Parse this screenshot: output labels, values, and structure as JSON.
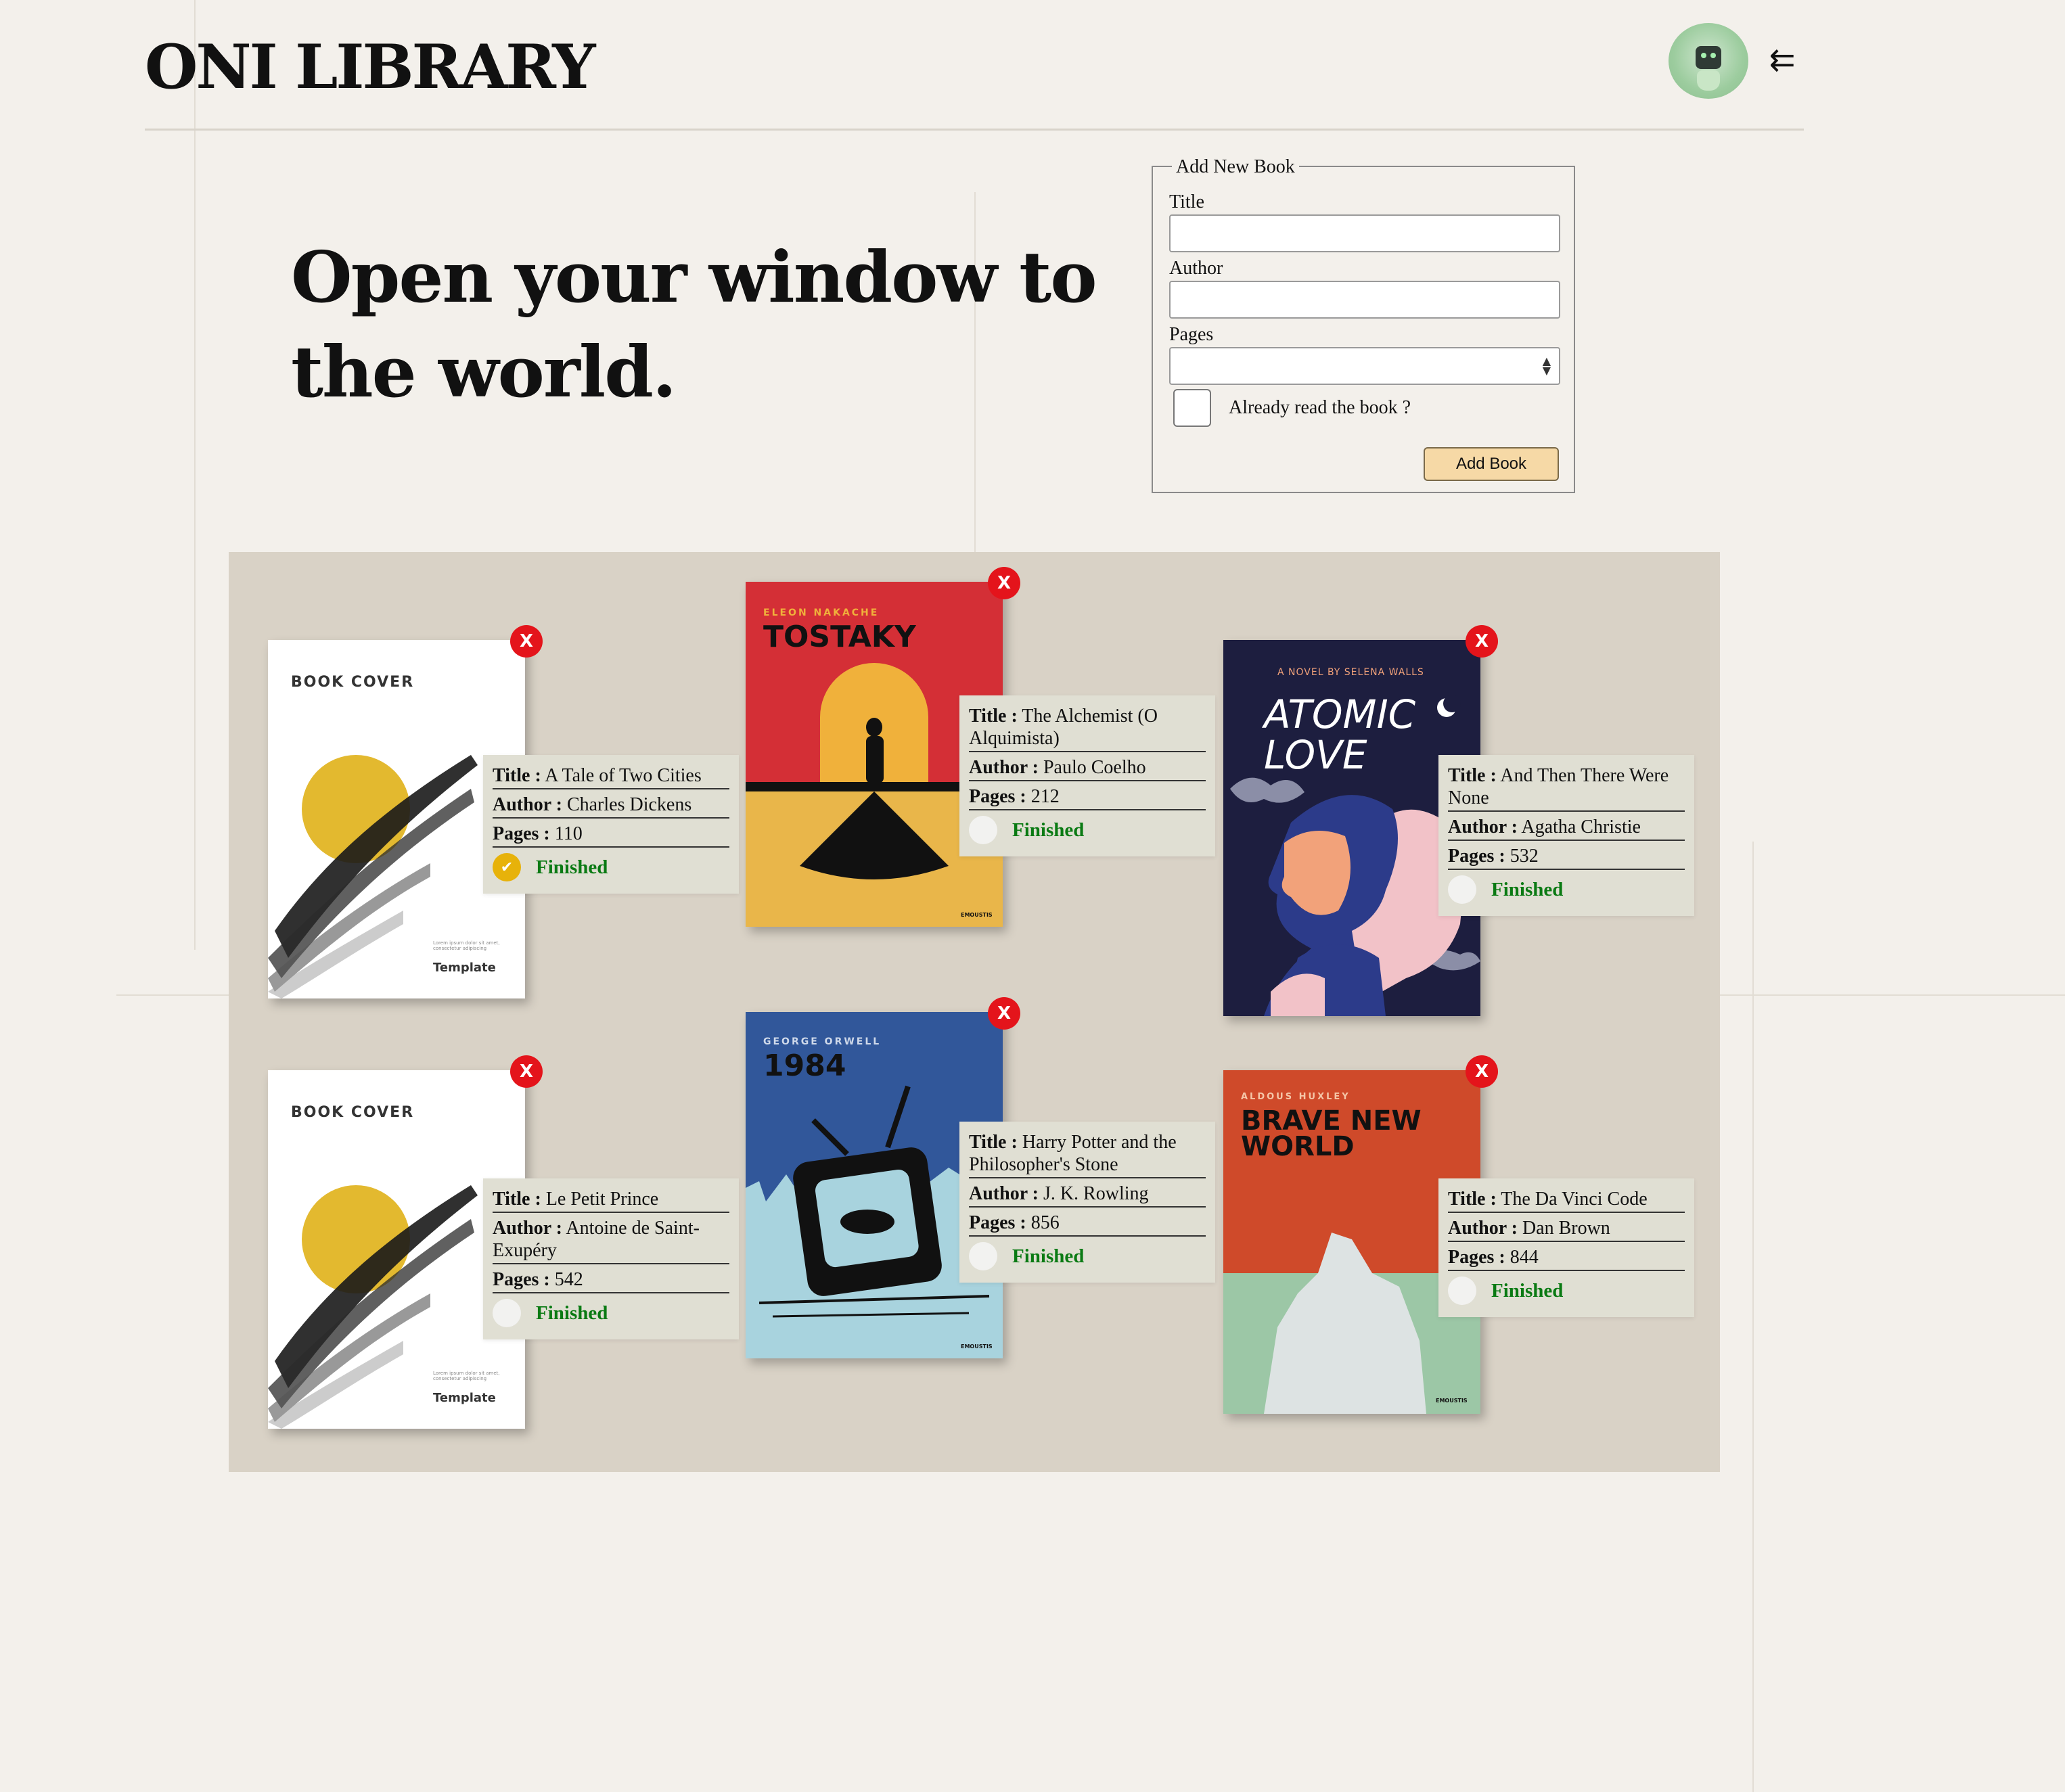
{
  "header": {
    "logo": "ONI LIBRARY",
    "menu_icon": "⇇"
  },
  "hero": {
    "headline": "Open your window to the world."
  },
  "form": {
    "legend": "Add New Book",
    "title_label": "Title",
    "title_value": "",
    "author_label": "Author",
    "author_value": "",
    "pages_label": "Pages",
    "pages_value": "",
    "read_label": "Already read the book ?",
    "submit_label": "Add Book"
  },
  "labels": {
    "title": "Title :",
    "author": "Author :",
    "pages": "Pages :",
    "delete": "X",
    "finished": "Finished",
    "check": "✔"
  },
  "books": [
    {
      "title": "A Tale of Two Cities",
      "author": "Charles Dickens",
      "pages": "110",
      "read": true,
      "cover": {
        "top": "BOOK COVER",
        "bottom": "Template",
        "fine": "Lorem ipsum dolor sit amet, consectetur adipiscing"
      }
    },
    {
      "title": "The Alchemist (O Alquimista)",
      "author": "Paulo Coelho",
      "pages": "212",
      "read": false,
      "cover": {
        "top": "ELEON NAKACHE",
        "bottom": "TOSTAKY",
        "fine": "EMOUSTIS"
      }
    },
    {
      "title": "And Then There Were None",
      "author": "Agatha Christie",
      "pages": "532",
      "read": false,
      "cover": {
        "top": "A NOVEL BY SELENA WALLS",
        "bottom": "ATOMIC LOVE",
        "fine": ""
      }
    },
    {
      "title": "Le Petit Prince",
      "author": "Antoine de Saint-Exupéry",
      "pages": "542",
      "read": false,
      "cover": {
        "top": "BOOK COVER",
        "bottom": "Template",
        "fine": "Lorem ipsum dolor sit amet, consectetur adipiscing"
      }
    },
    {
      "title": "Harry Potter and the Philosopher's Stone",
      "author": "J. K. Rowling",
      "pages": "856",
      "read": false,
      "cover": {
        "top": "GEORGE ORWELL",
        "bottom": "1984",
        "fine": "EMOUSTIS"
      }
    },
    {
      "title": "The Da Vinci Code",
      "author": "Dan Brown",
      "pages": "844",
      "read": false,
      "cover": {
        "top": "ALDOUS HUXLEY",
        "bottom": "BRAVE NEW WORLD",
        "fine": "EMOUSTIS"
      }
    }
  ],
  "colors": {
    "background": "#f3f0eb",
    "shelf": "#d9d2c6",
    "delete": "#e4141b",
    "finished_text": "#0a7a13",
    "read_check": "#e7b20a",
    "button": "#f6d9a6"
  }
}
